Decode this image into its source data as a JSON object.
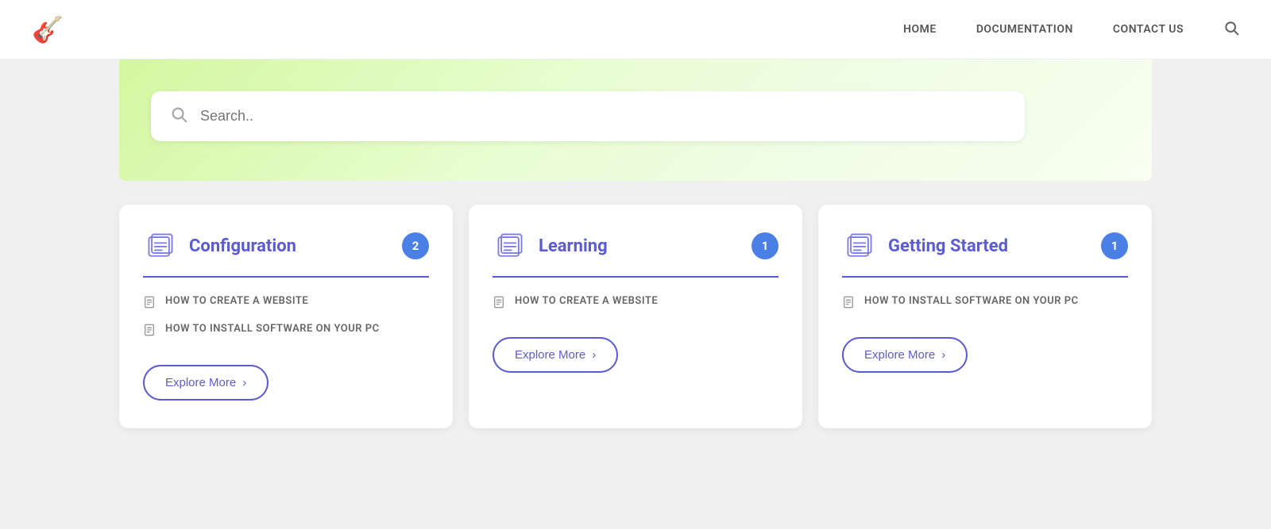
{
  "navbar": {
    "logo": "🎸",
    "links": [
      {
        "label": "HOME",
        "id": "home"
      },
      {
        "label": "DOCUMENTATION",
        "id": "documentation"
      },
      {
        "label": "CONTACT US",
        "id": "contact"
      }
    ],
    "search_icon": "🔍"
  },
  "hero": {
    "search_placeholder": "Search.."
  },
  "cards": [
    {
      "id": "configuration",
      "title": "Configuration",
      "badge": "2",
      "items": [
        {
          "text": "HOW TO CREATE A WEBSITE"
        },
        {
          "text": "HOW TO INSTALL SOFTWARE ON YOUR PC"
        }
      ],
      "explore_label": "Explore More",
      "explore_arrow": "›"
    },
    {
      "id": "learning",
      "title": "Learning",
      "badge": "1",
      "items": [
        {
          "text": "HOW TO CREATE A WEBSITE"
        }
      ],
      "explore_label": "Explore More",
      "explore_arrow": "›"
    },
    {
      "id": "getting-started",
      "title": "Getting Started",
      "badge": "1",
      "items": [
        {
          "text": "HOW TO INSTALL SOFTWARE ON YOUR PC"
        }
      ],
      "explore_label": "Explore More",
      "explore_arrow": "›"
    }
  ]
}
